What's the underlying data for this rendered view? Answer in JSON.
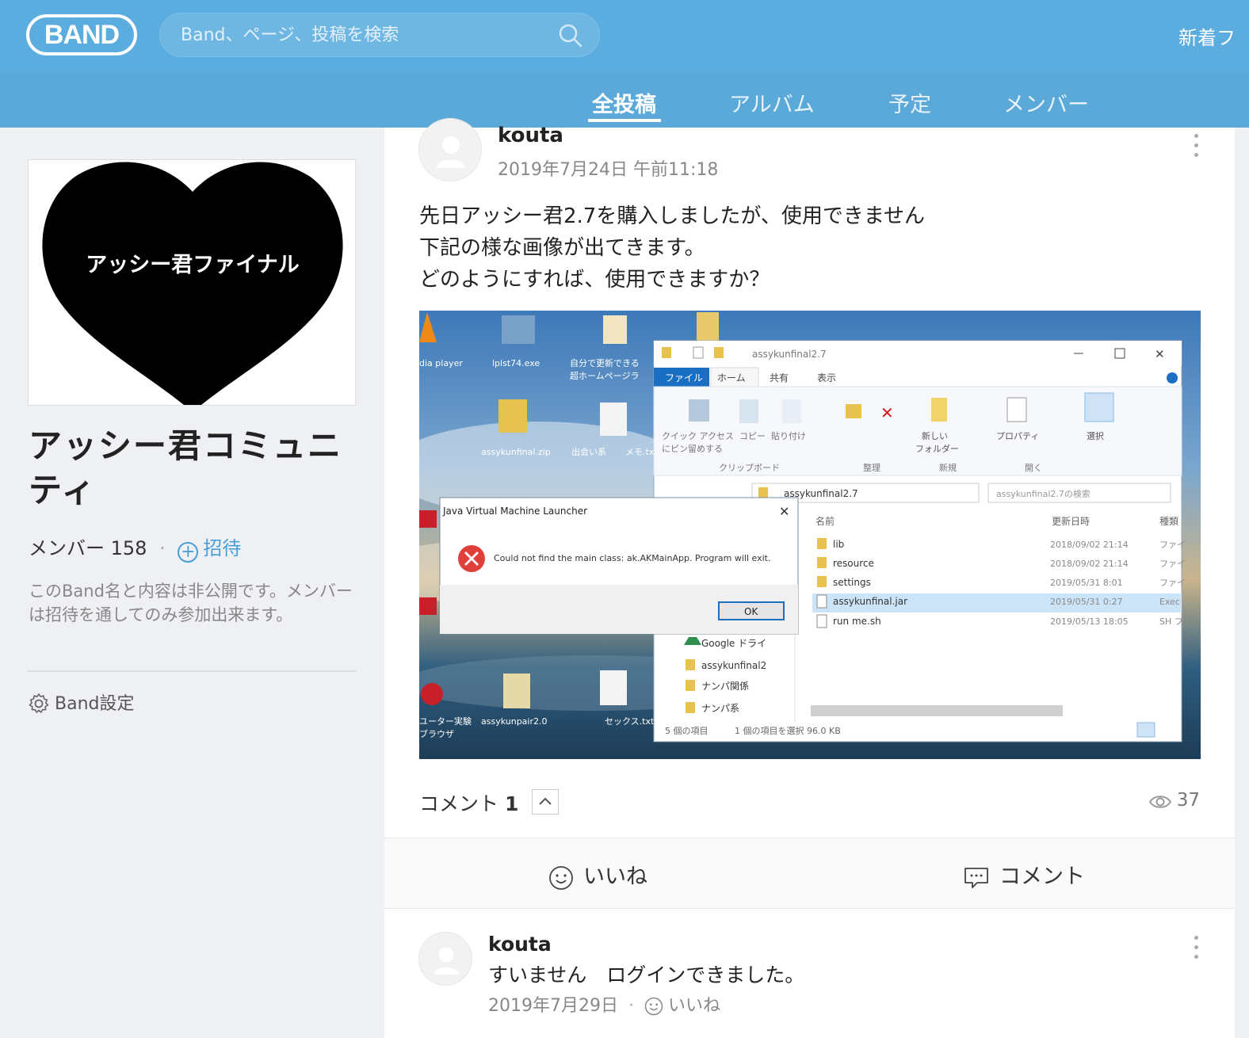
{
  "header": {
    "logo": "BAND",
    "search_placeholder": "Band、ページ、投稿を検索",
    "new_files": "新着フ"
  },
  "tabs": [
    {
      "label": "全投稿",
      "active": true
    },
    {
      "label": "アルバム",
      "active": false
    },
    {
      "label": "予定",
      "active": false
    },
    {
      "label": "メンバー",
      "active": false
    }
  ],
  "sidebar": {
    "cover_text": "アッシー君ファイナル",
    "band_name": "アッシー君コミュニティ",
    "members_label": "メンバー",
    "members_count": "158",
    "invite_label": "招待",
    "description": "このBand名と内容は非公開です。メンバーは招待を通してのみ参加出来ます。",
    "settings_label": "Band設定"
  },
  "post": {
    "author": "kouta",
    "date": "2019年7月24日 午前11:18",
    "body_lines": [
      "先日アッシー君2.7を購入しましたが、使用できません",
      "下記の様な画像が出てきます。",
      "どのようにすれば、使用できますか？"
    ],
    "comment_label": "コメント",
    "comment_count": "1",
    "views": "37",
    "like_label": "いいね",
    "comment_button": "コメント"
  },
  "screenshot": {
    "explorer_title": "assykunfinal2.7",
    "ribbon_tabs": [
      "ファイル",
      "ホーム",
      "共有",
      "表示"
    ],
    "ribbon_groups": [
      "クリップボード",
      "整理",
      "新規",
      "開く"
    ],
    "ribbon_labels": [
      "クイック アクセス",
      "にピン留めする",
      "コピー",
      "貼り付け",
      "新しい",
      "フォルダー",
      "プロパティ",
      "選択"
    ],
    "path": "assykunfinal2.7",
    "search_placeholder": "assykunfinal2.7の検索",
    "col_name": "名前",
    "col_date": "更新日時",
    "col_type": "種類",
    "files": [
      {
        "name": "lib",
        "date": "2018/09/02 21:14",
        "type": "ファイ"
      },
      {
        "name": "resource",
        "date": "2018/09/02 21:14",
        "type": "ファイ"
      },
      {
        "name": "settings",
        "date": "2019/05/31 8:01",
        "type": "ファイ"
      },
      {
        "name": "assykunfinal.jar",
        "date": "2019/05/31 0:27",
        "type": "Exec"
      },
      {
        "name": "run me.sh",
        "date": "2019/05/13 18:05",
        "type": "SH フ"
      }
    ],
    "nav_items": [
      "Google ドライ",
      "assykunfinal2",
      "ナンパ関係",
      "ナンパ系"
    ],
    "status_left": "5 個の項目",
    "status_right": "1 個の項目を選択  96.0 KB",
    "dialog_title": "Java Virtual Machine Launcher",
    "dialog_message": "Could not find the main class: ak.AKMainApp. Program will exit.",
    "dialog_ok": "OK",
    "desktop_icons": [
      "dia player",
      "lplst74.exe",
      "自分で更新できる",
      "超ホームページラ",
      "assykunfinal.zip",
      "出会い系",
      "メモ.txt",
      "assykunpair2.0",
      "ユーター実験",
      "セックス.txt",
      "ブラウザ"
    ]
  },
  "comment": {
    "author": "kouta",
    "body": "すいません　ログインできました。",
    "date": "2019年7月29日",
    "like_label": "いいね"
  }
}
